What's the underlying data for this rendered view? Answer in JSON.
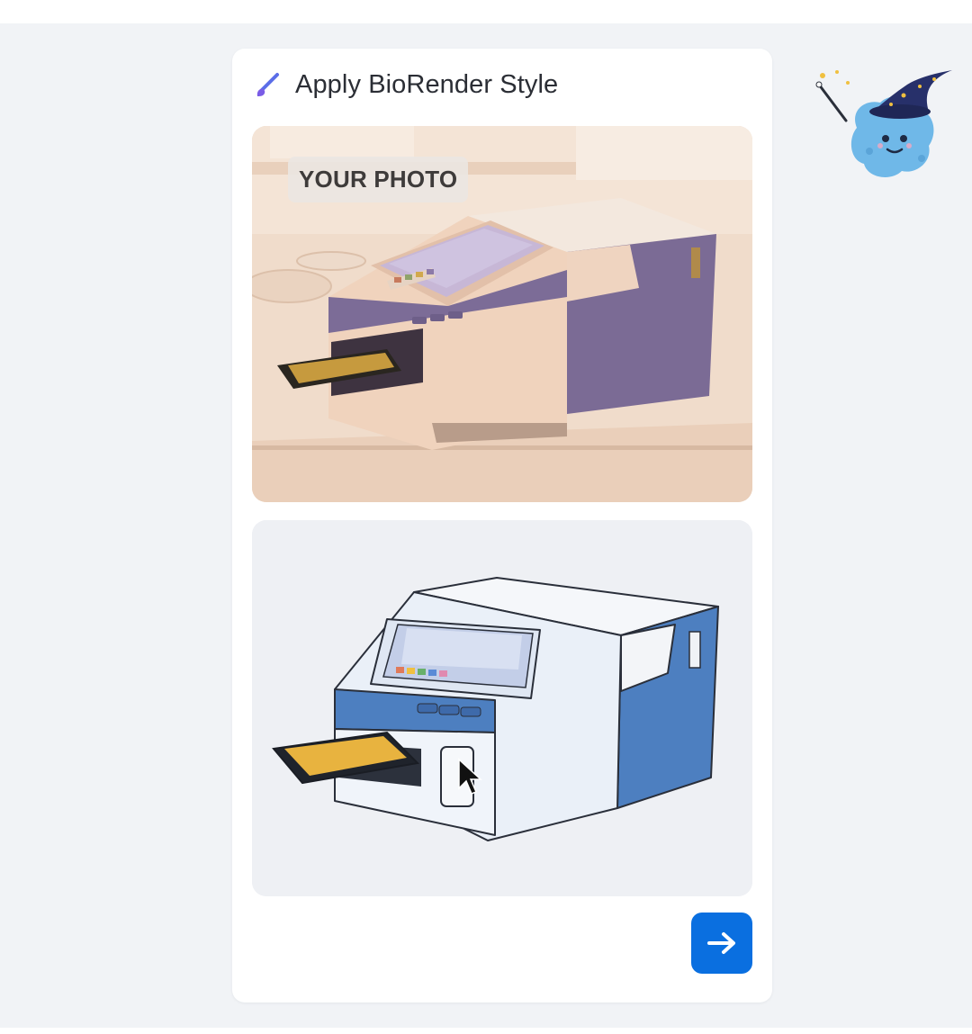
{
  "card": {
    "title": "Apply BioRender Style",
    "title_icon": "paintbrush-icon"
  },
  "photo_panel": {
    "tag_label": "YOUR PHOTO",
    "image_subject": "laboratory plate reader photo"
  },
  "styled_panel": {
    "image_subject": "BioRender-styled plate reader illustration"
  },
  "next_button": {
    "icon": "arrow-right-icon"
  },
  "mascot": {
    "icon": "wizard-mascot-icon"
  },
  "colors": {
    "page_background": "#f1f3f6",
    "card_background": "#ffffff",
    "accent_blue": "#0a6fe0",
    "illustration_blue": "#4d7fc0",
    "photo_purple": "#7d6c96"
  }
}
